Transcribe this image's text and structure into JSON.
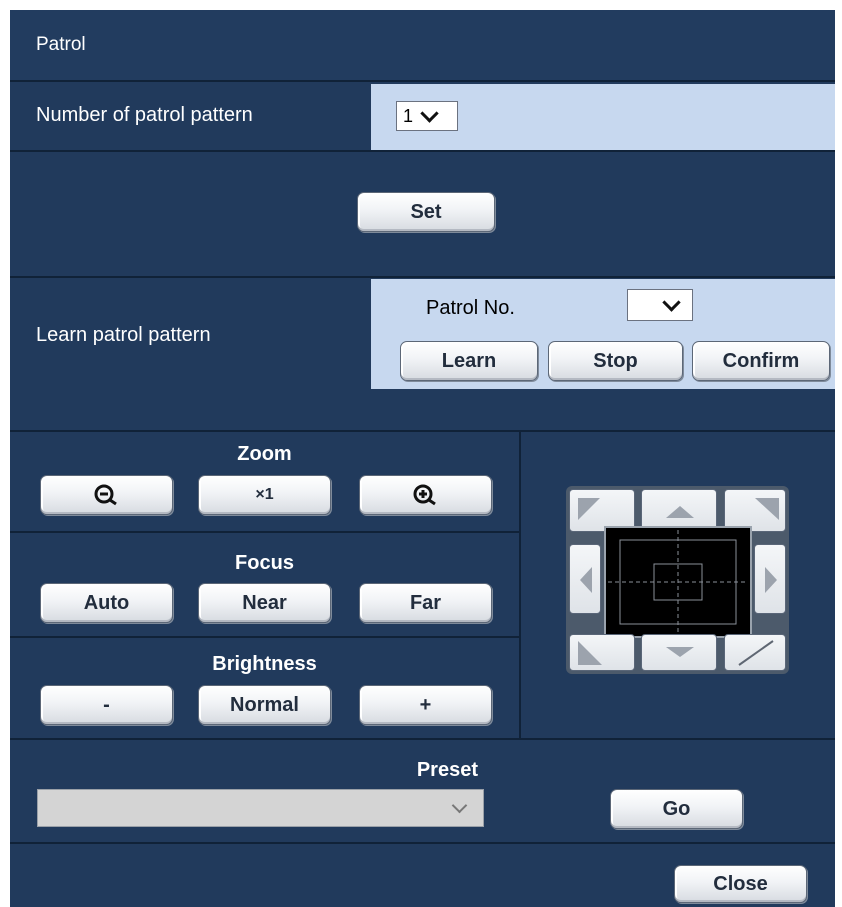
{
  "title": "Patrol",
  "number_of_patrol_pattern": {
    "label": "Number of patrol pattern",
    "value": "1"
  },
  "set_button": "Set",
  "learn_patrol": {
    "label": "Learn patrol pattern",
    "patrol_no_label": "Patrol No.",
    "patrol_no_value": "",
    "learn_button": "Learn",
    "stop_button": "Stop",
    "confirm_button": "Confirm"
  },
  "zoom": {
    "title": "Zoom",
    "zoom_out_icon": "zoom-out-icon",
    "reset_label": "×1",
    "zoom_in_icon": "zoom-in-icon"
  },
  "focus": {
    "title": "Focus",
    "auto": "Auto",
    "near": "Near",
    "far": "Far"
  },
  "brightness": {
    "title": "Brightness",
    "minus": "-",
    "normal": "Normal",
    "plus": "+"
  },
  "preset": {
    "title": "Preset",
    "selected": "",
    "go_button": "Go"
  },
  "close_button": "Close",
  "colors": {
    "panel": "#213a5c",
    "light_row": "#c7d8ef",
    "divider": "#102238"
  }
}
